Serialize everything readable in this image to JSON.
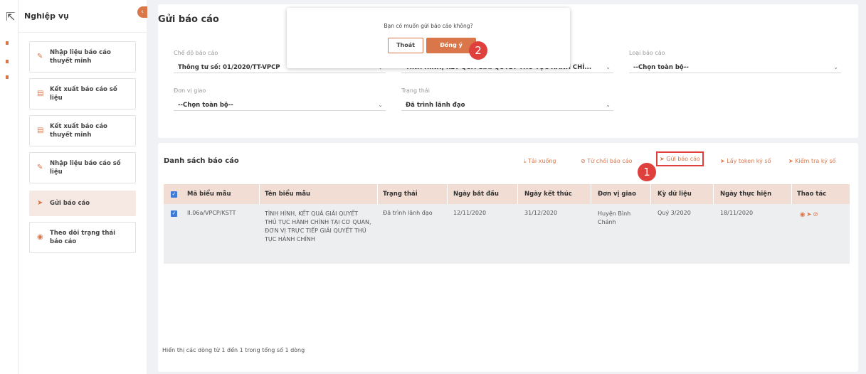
{
  "sidebar": {
    "title": "Nghiệp vụ",
    "collapse_glyph": "‹",
    "items": [
      {
        "label": "Nhập liệu báo cáo thuyết minh",
        "icon": "pencil-icon"
      },
      {
        "label": "Kết xuất báo cáo số liệu",
        "icon": "table-icon"
      },
      {
        "label": "Kết xuất báo cáo thuyết minh",
        "icon": "table-icon"
      },
      {
        "label": "Nhập liệu báo cáo số liệu",
        "icon": "pencil-icon"
      },
      {
        "label": "Gửi báo cáo",
        "icon": "send-icon"
      },
      {
        "label": "Theo dõi trạng thái báo cáo",
        "icon": "eye-icon"
      }
    ]
  },
  "page": {
    "title": "Gửi báo cáo"
  },
  "filters": {
    "regime": {
      "label": "Chế độ báo cáo",
      "value": "Thông tư số: 01/2020/TT-VPCP"
    },
    "report_name": {
      "value": "TÌNH HÌNH, KẾT QUẢ GIẢI QUYẾT THỦ TỤC HÀNH CHÍ..."
    },
    "report_type": {
      "label": "Loại báo cáo",
      "value": "--Chọn toàn bộ--"
    },
    "unit": {
      "label": "Đơn vị giao",
      "value": "--Chọn toàn bộ--"
    },
    "status": {
      "label": "Trạng thái",
      "value": "Đã trình lãnh đạo"
    }
  },
  "list": {
    "title": "Danh sách báo cáo",
    "actions": {
      "download": "Tải xuống",
      "reject": "Từ chối báo cáo",
      "send": "Gửi báo cáo",
      "get_token": "Lấy token ký số",
      "check_signature": "Kiểm tra ký số"
    },
    "columns": [
      "Mã biểu mẫu",
      "Tên biểu mẫu",
      "Trạng thái",
      "Ngày bắt đầu",
      "Ngày kết thúc",
      "Đơn vị giao",
      "Kỳ dữ liệu",
      "Ngày thực hiện",
      "Thao tác"
    ],
    "rows": [
      {
        "code": "II.06a/VPCP/KSTT",
        "name": "TÌNH HÌNH, KẾT QUẢ GIẢI QUYẾT THỦ TỤC HÀNH CHÍNH TẠI CƠ QUAN, ĐƠN VỊ TRỰC TIẾP GIẢI QUYẾT THỦ TỤC HÀNH CHÍNH",
        "status": "Đã trình lãnh đạo",
        "start_date": "12/11/2020",
        "end_date": "31/12/2020",
        "unit": "Huyện Bình Chánh",
        "period": "Quý 3/2020",
        "exec_date": "18/11/2020",
        "checked": true
      }
    ],
    "footer": "Hiển thị các dòng từ 1 đến 1 trong tổng số 1 dòng"
  },
  "dialog": {
    "message": "Bạn có muốn gửi báo cáo không?",
    "cancel_label": "Thoát",
    "ok_label": "Đồng ý"
  },
  "callouts": {
    "step1": "1",
    "step2": "2"
  },
  "colors": {
    "accent": "#d9764a",
    "highlight": "#e0403c",
    "header_row": "#f2ddd4",
    "checkbox": "#3f7bd6"
  }
}
